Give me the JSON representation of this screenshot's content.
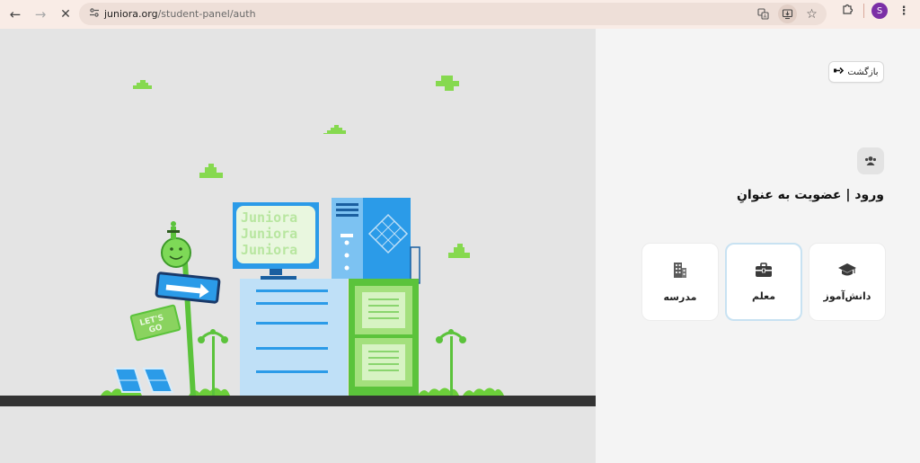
{
  "browser": {
    "url_host": "juniora.org",
    "url_path": "/student-panel/auth",
    "profile_initial": "S"
  },
  "icons": {
    "back": "arrow-left-icon",
    "forward": "arrow-right-icon",
    "stop": "close-icon",
    "site_info": "tune-icon",
    "translate": "translate-icon",
    "install": "install-app-icon",
    "bookmark": "star-icon",
    "extensions": "puzzle-icon",
    "menu": "more-vert-icon"
  },
  "illustration": {
    "monitor_text": [
      "Juniora",
      "Juniora",
      "Juniora"
    ],
    "sign_text": [
      "LET'S",
      "GO"
    ]
  },
  "auth": {
    "back_label": "بازگشت",
    "title": "ورود | عضویت به عنوانِ",
    "roles": [
      {
        "label": "دانش‌آموز",
        "icon": "graduation-cap-icon"
      },
      {
        "label": "معلم",
        "icon": "briefcase-icon"
      },
      {
        "label": "مدرسه",
        "icon": "building-icon"
      }
    ]
  },
  "colors": {
    "accent_green": "#5bc33b",
    "accent_blue": "#2b9be8",
    "selected_border": "#c8e2f2"
  }
}
